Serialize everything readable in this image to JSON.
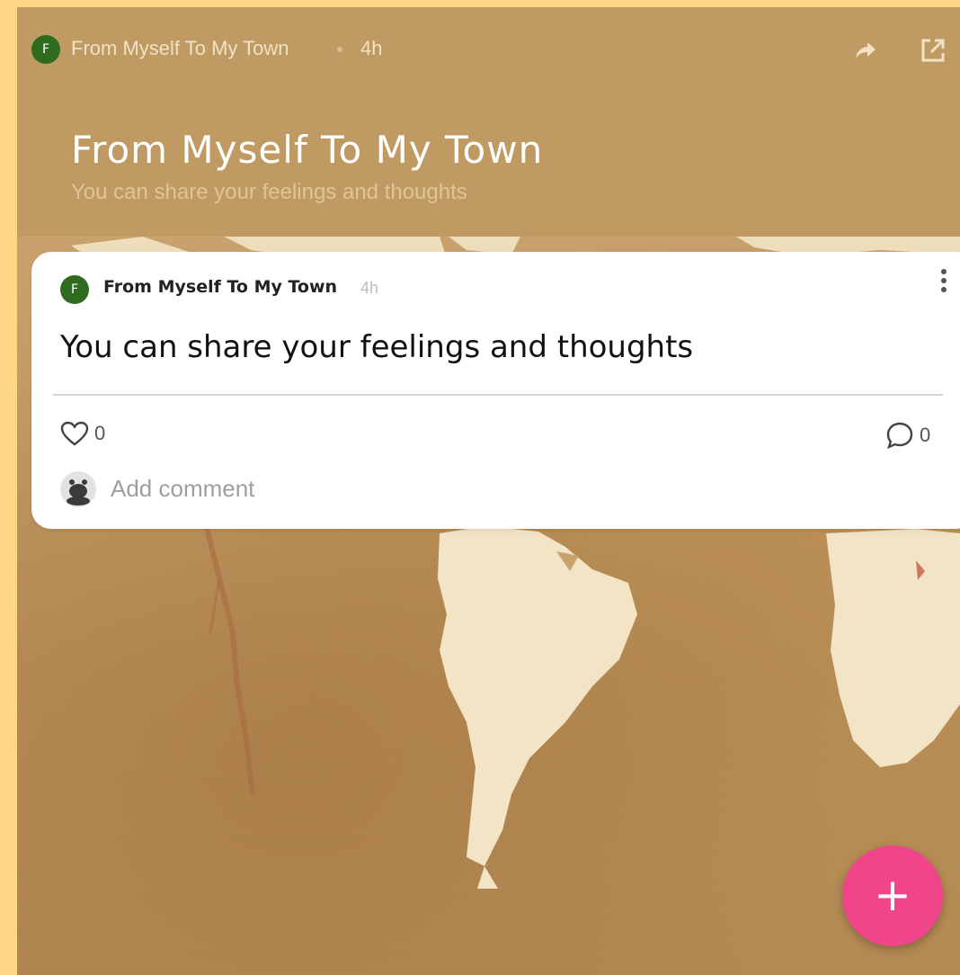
{
  "header": {
    "avatar_initial": "F",
    "author": "From Myself To My Town",
    "time": "4h",
    "share_icon": "share-arrow-icon",
    "open_icon": "open-external-icon"
  },
  "hero": {
    "title": "From Myself To My Town",
    "subtitle": "You can share your feelings and thoughts"
  },
  "post": {
    "avatar_initial": "F",
    "author": "From Myself To My Town",
    "time": "4h",
    "body": "You can share your feelings and thoughts",
    "likes": "0",
    "comments": "0",
    "comment_placeholder": "Add comment",
    "more_icon": "more-vertical-icon"
  },
  "fab": {
    "label": "+"
  },
  "colors": {
    "page_border": "#FFD684",
    "header_bg": "#BF9A62",
    "avatar_green": "#2E6B1E",
    "fab_pink": "#F0458B",
    "card_bg": "#FFFFFF"
  }
}
